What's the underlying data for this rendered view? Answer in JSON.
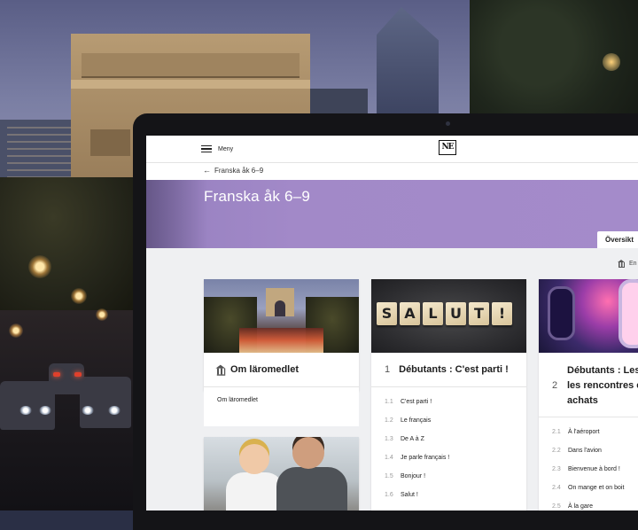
{
  "app": {
    "menu_label": "Meny",
    "logo_text": "NE",
    "breadcrumb": "Franska åk 6–9",
    "course_title": "Franska åk 6–9",
    "tab_overview": "Översikt",
    "subtab_label": "En"
  },
  "cards": {
    "om": {
      "title": "Om läromedlet",
      "link": "Om läromedlet"
    },
    "debutants": {
      "number": "1",
      "title": "Débutants : C'est parti !",
      "tiles": [
        "S",
        "A",
        "L",
        "U",
        "T",
        "!"
      ],
      "items": [
        {
          "num": "1.1",
          "label": "C'est parti !"
        },
        {
          "num": "1.2",
          "label": "Le français"
        },
        {
          "num": "1.3",
          "label": "De A à Z"
        },
        {
          "num": "1.4",
          "label": "Je parle français !"
        },
        {
          "num": "1.5",
          "label": "Bonjour !"
        },
        {
          "num": "1.6",
          "label": "Salut !"
        }
      ]
    },
    "rencontres": {
      "number": "2",
      "title_line1": "Débutants : Les",
      "title_line2": "les rencontres e",
      "title_line3": "achats",
      "items": [
        {
          "num": "2.1",
          "label": "À l'aéroport"
        },
        {
          "num": "2.2",
          "label": "Dans l'avion"
        },
        {
          "num": "2.3",
          "label": "Bienvenue à bord !"
        },
        {
          "num": "2.4",
          "label": "On mange et on boit"
        },
        {
          "num": "2.5",
          "label": "À la gare"
        }
      ]
    }
  },
  "colors": {
    "hero": "#a48bca",
    "content_bg": "#eff0f2"
  },
  "icons": {
    "menu": "hamburger-icon",
    "back": "arrow-left-icon",
    "om": "institution-icon"
  }
}
